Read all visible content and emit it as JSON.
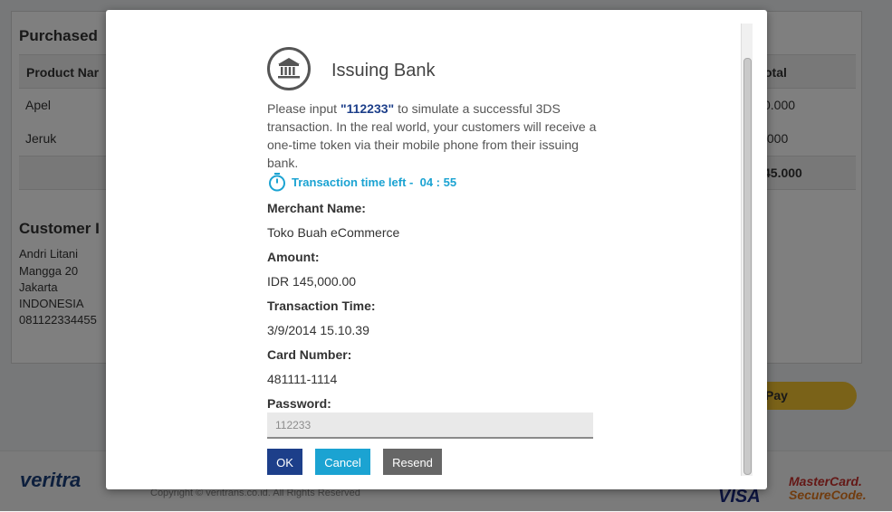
{
  "background": {
    "section_title": "Purchased",
    "table": {
      "headers": [
        "Product Nar",
        "otal"
      ],
      "rows": [
        {
          "name": "Apel",
          "total": "0.000"
        },
        {
          "name": "Jeruk",
          "total": ".000"
        }
      ],
      "grand_total": "45.000"
    },
    "customer": {
      "title": "Customer I",
      "lines": [
        "Andri Litani",
        "Mangga 20",
        "Jakarta",
        "INDONESIA",
        "081122334455"
      ]
    },
    "pay_button": "Pay",
    "footer": {
      "logo": "veritra",
      "copyright": "Copyright © veritrans.co.id. All Rights Reserved",
      "visa": "VISA",
      "mastercard_line1": "MasterCard.",
      "mastercard_line2": "SecureCode."
    }
  },
  "modal": {
    "title": "Issuing Bank",
    "icon": "bank-icon",
    "instruction_pre": "Please input ",
    "code": "\"112233\"",
    "instruction_post": " to simulate a successful 3DS transaction. In the real world, your customers will receive a one-time token via their mobile phone from their issuing bank.",
    "timer_label": "Transaction time left -  04 : 55",
    "fields": {
      "merchant_label": "Merchant Name:",
      "merchant_value": "Toko Buah eCommerce",
      "amount_label": "Amount:",
      "amount_value": "IDR 145,000.00",
      "time_label": "Transaction Time:",
      "time_value": "3/9/2014 15.10.39",
      "card_label": "Card Number:",
      "card_value": "481111-1114",
      "password_label": "Password:",
      "password_placeholder": "112233"
    },
    "buttons": {
      "ok": "OK",
      "cancel": "Cancel",
      "resend": "Resend"
    },
    "colors": {
      "ok": "#1d3f8a",
      "cancel": "#1ba3d2",
      "resend": "#666666",
      "timer": "#1ba3d2"
    }
  }
}
